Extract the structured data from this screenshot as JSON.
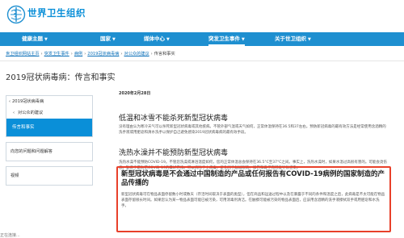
{
  "header": {
    "site_title": "世界卫生组织"
  },
  "nav": {
    "items": [
      {
        "label": "健康主题"
      },
      {
        "label": "国家"
      },
      {
        "label": "媒体中心"
      },
      {
        "label": "突发卫生事件"
      },
      {
        "label": "关于世卫组织"
      }
    ]
  },
  "breadcrumb": [
    "世卫组织网站主页",
    "突发卫生事件",
    "病例",
    "2019冠状病毒病",
    "对公众的建议",
    "传言和事实"
  ],
  "page_title": "2019冠状病毒病：传言和事实",
  "sidebar": {
    "parent": "2019冠状病毒病",
    "sub": "对公众的建议",
    "active": "传言和事实",
    "links": [
      "向您的问题和问题解答",
      "视频"
    ]
  },
  "content": {
    "date": "2020年2月28日",
    "sections": [
      {
        "title": "低温和冰雪不能杀死新型冠状病毒",
        "body": "没有理由认为寒冷天气可以杀死新型冠状病毒或其他疾病。不管外部气温或天气如何，正常体温保持在36.5和37左右。预防新冠病毒的最有效方法是经常使用含酒精的洗手液或用肥皂和清水洗手以保护自己避免感染2019冠状病毒病的最有效手段。"
      },
      {
        "title": "洗热水澡并不能预防新型冠状病毒",
        "body": "洗热水澡不能预防COVID-19。不管您洗澡或淋浴温度如何，您的正常体温总会保持在36.5°C至37°C之间。事实上，洗热水澡时，如果水温过高很有害的。可能会烫伤您。勤洗手是防范COVID-19的最好方法。可以清除手上病毒，避免因手触碰眼睛、嘴巴和鼻子而可能导致感染。"
      },
      {
        "title": "新型冠状病毒是不会通过中国制造的产品或任何报告有COVID-19病例的国家制造的产品传播的",
        "body": "新型冠状病毒可在物品表面停留数小时或数天（存活时间取决于表面的类型），但在商品和运送过程中以及在暴露于不同的条件和温度之后，此病毒是不太可能在物品表面存留很长时间。如果您认为某一物品表面可能已被污染，可用消毒剂清洁。在触摸可能被污染的物品表面后，应该用含酒精的洗手液擦拭双手或用肥皂和水洗手。"
      }
    ]
  },
  "status_bar": "正在连接..."
}
